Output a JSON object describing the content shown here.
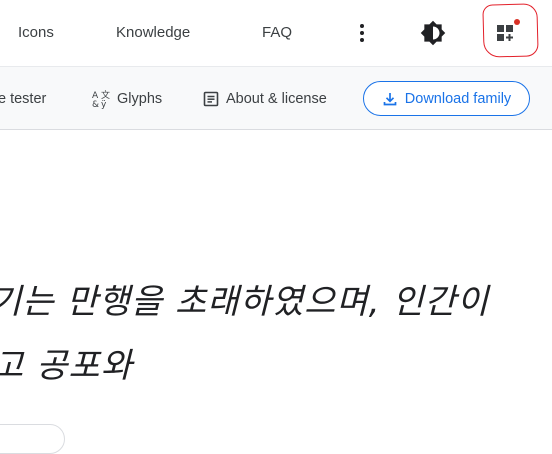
{
  "nav": {
    "icons": "Icons",
    "knowledge": "Knowledge",
    "faq": "FAQ"
  },
  "toolbar": {
    "type_tester": "e tester",
    "glyphs": "Glyphs",
    "about": "About & license",
    "download": "Download family"
  },
  "sample_text": {
    "line1": "기는 만행을 초래하였으며, 인간이",
    "line2": "고 공포와"
  },
  "icons": {
    "more": "more-vert-icon",
    "theme": "theme-toggle-icon",
    "apps": "apps-icon",
    "glyphs": "glyphs-icon",
    "about": "article-icon",
    "download": "download-icon"
  },
  "colors": {
    "accent": "#1a73e8",
    "notification": "#d93025",
    "annotation": "#e3202a"
  }
}
